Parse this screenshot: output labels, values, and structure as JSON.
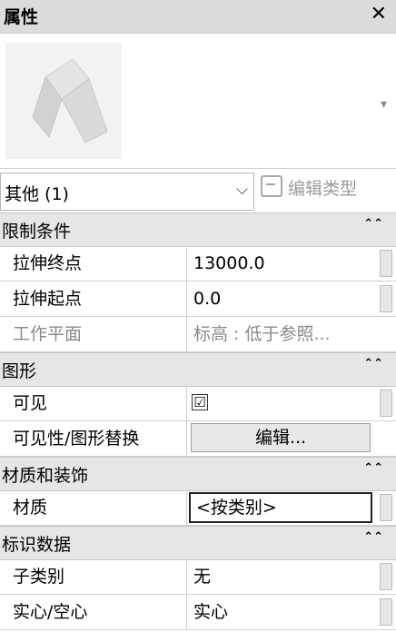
{
  "panel": {
    "title": "属性",
    "close_glyph": "✕"
  },
  "preview": {
    "dropdown_glyph": "▾"
  },
  "type_selector": {
    "label": "其他 (1)",
    "chevron": "⌵",
    "edit_type": "编辑类型"
  },
  "sections": [
    {
      "title": "限制条件",
      "collapse_glyph": "⌃⌃",
      "rows": [
        {
          "name": "拉伸终点",
          "value": "13000.0"
        },
        {
          "name": "拉伸起点",
          "value": "0.0"
        },
        {
          "name": "工作平面",
          "value": "标高 : 低于参照..."
        }
      ]
    },
    {
      "title": "图形",
      "collapse_glyph": "⌃⌃",
      "rows": [
        {
          "name": "可见",
          "value": "☑"
        },
        {
          "name": "可见性/图形替换",
          "value": "编辑..."
        }
      ]
    },
    {
      "title": "材质和装饰",
      "collapse_glyph": "⌃⌃",
      "rows": [
        {
          "name": "材质",
          "value": "<按类别>"
        }
      ]
    },
    {
      "title": "标识数据",
      "collapse_glyph": "⌃⌃",
      "rows": [
        {
          "name": "子类别",
          "value": "无"
        },
        {
          "name": "实心/空心",
          "value": "实心"
        }
      ]
    }
  ]
}
